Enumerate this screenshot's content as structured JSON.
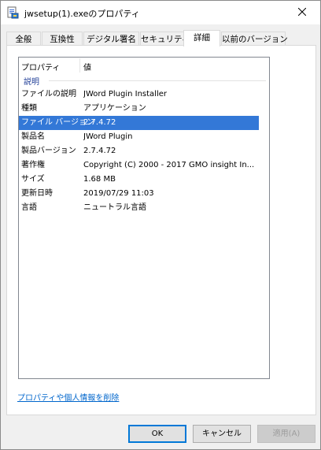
{
  "window": {
    "title": "jwsetup(1).exeのプロパティ"
  },
  "tabs": [
    {
      "label": "全般",
      "active": false
    },
    {
      "label": "互換性",
      "active": false
    },
    {
      "label": "デジタル署名",
      "active": false
    },
    {
      "label": "セキュリティ",
      "active": false
    },
    {
      "label": "詳細",
      "active": true
    },
    {
      "label": "以前のバージョン",
      "active": false
    }
  ],
  "details": {
    "columns": {
      "property": "プロパティ",
      "value": "値"
    },
    "group": "説明",
    "rows": [
      {
        "property": "ファイルの説明",
        "value": "JWord Plugin Installer",
        "selected": false
      },
      {
        "property": "種類",
        "value": "アプリケーション",
        "selected": false
      },
      {
        "property": "ファイル バージョン",
        "value": "2.7.4.72",
        "selected": true
      },
      {
        "property": "製品名",
        "value": "JWord Plugin",
        "selected": false
      },
      {
        "property": "製品バージョン",
        "value": "2.7.4.72",
        "selected": false
      },
      {
        "property": "著作権",
        "value": "Copyright (C) 2000 - 2017 GMO insight In...",
        "selected": false
      },
      {
        "property": "サイズ",
        "value": "1.68 MB",
        "selected": false
      },
      {
        "property": "更新日時",
        "value": "2019/07/29 11:03",
        "selected": false
      },
      {
        "property": "言語",
        "value": "ニュートラル言語",
        "selected": false
      }
    ]
  },
  "links": {
    "remove_properties": "プロパティや個人情報を削除"
  },
  "buttons": {
    "ok": "OK",
    "cancel": "キャンセル",
    "apply": "適用(A)",
    "apply_enabled": false
  },
  "colors": {
    "selection": "#3378d7",
    "link": "#0066cc",
    "group": "#1e3c96"
  },
  "icons": {
    "title": "file-properties-icon",
    "close": "close-icon"
  }
}
